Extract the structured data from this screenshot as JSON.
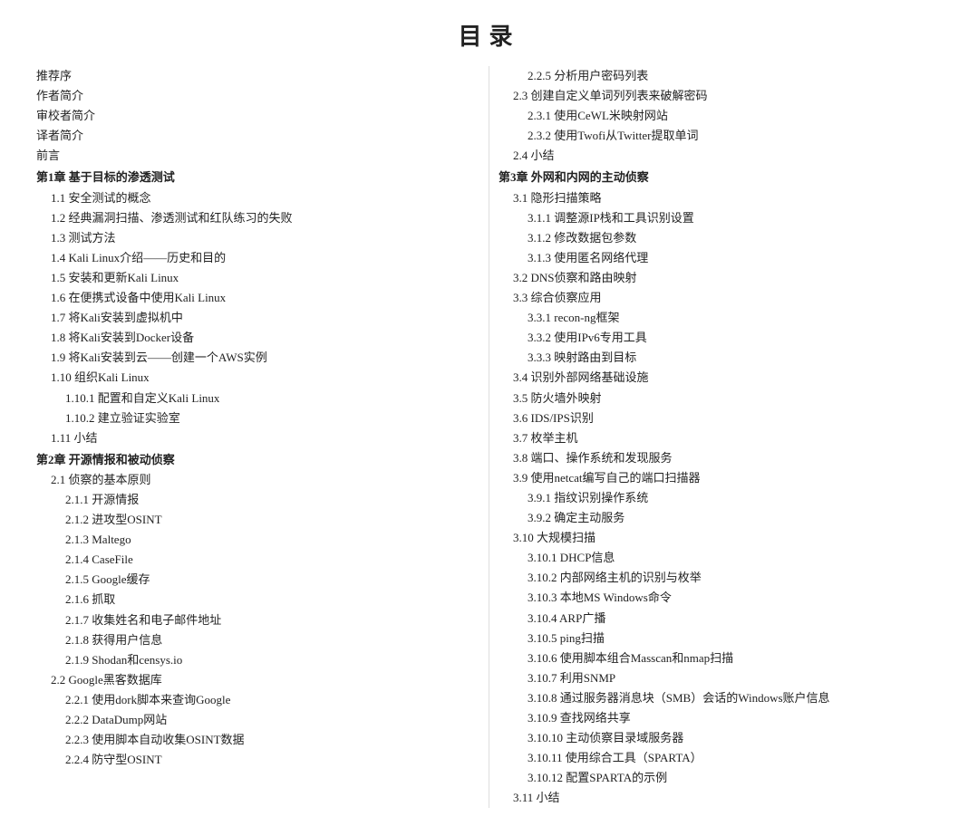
{
  "title": "目录",
  "left_col": [
    {
      "level": "plain",
      "text": "推荐序"
    },
    {
      "level": "plain",
      "text": "作者简介"
    },
    {
      "level": "plain",
      "text": "审校者简介"
    },
    {
      "level": "plain",
      "text": "译者简介"
    },
    {
      "level": "plain",
      "text": "前言"
    },
    {
      "level": "chapter",
      "text": "第1章   基于目标的渗透测试"
    },
    {
      "level": "section",
      "text": "1.1   安全测试的概念"
    },
    {
      "level": "section",
      "text": "1.2   经典漏洞扫描、渗透测试和红队练习的失败"
    },
    {
      "level": "section",
      "text": "1.3   测试方法"
    },
    {
      "level": "section",
      "text": "1.4   Kali   Linux介绍——历史和目的"
    },
    {
      "level": "section",
      "text": "1.5   安装和更新Kali   Linux"
    },
    {
      "level": "section",
      "text": "1.6   在便携式设备中使用Kali   Linux"
    },
    {
      "level": "section",
      "text": "1.7   将Kali安装到虚拟机中"
    },
    {
      "level": "section",
      "text": "1.8   将Kali安装到Docker设备"
    },
    {
      "level": "section",
      "text": "1.9   将Kali安装到云——创建一个AWS实例"
    },
    {
      "level": "section",
      "text": "1.10   组织Kali   Linux"
    },
    {
      "level": "subsection",
      "text": "1.10.1   配置和自定义Kali   Linux"
    },
    {
      "level": "subsection",
      "text": "1.10.2   建立验证实验室"
    },
    {
      "level": "section",
      "text": "1.11   小结"
    },
    {
      "level": "chapter",
      "text": "第2章   开源情报和被动侦察"
    },
    {
      "level": "section",
      "text": "2.1   侦察的基本原则"
    },
    {
      "level": "subsection",
      "text": "2.1.1   开源情报"
    },
    {
      "level": "subsection",
      "text": "2.1.2   进攻型OSINT"
    },
    {
      "level": "subsection",
      "text": "2.1.3   Maltego"
    },
    {
      "level": "subsection",
      "text": "2.1.4   CaseFile"
    },
    {
      "level": "subsection",
      "text": "2.1.5   Google缓存"
    },
    {
      "level": "subsection",
      "text": "2.1.6   抓取"
    },
    {
      "level": "subsection",
      "text": "2.1.7   收集姓名和电子邮件地址"
    },
    {
      "level": "subsection",
      "text": "2.1.8   获得用户信息"
    },
    {
      "level": "subsection",
      "text": "2.1.9   Shodan和censys.io"
    },
    {
      "level": "section",
      "text": "2.2   Google黑客数据库"
    },
    {
      "level": "subsection",
      "text": "2.2.1   使用dork脚本来查询Google"
    },
    {
      "level": "subsection",
      "text": "2.2.2   DataDump网站"
    },
    {
      "level": "subsection",
      "text": "2.2.3   使用脚本自动收集OSINT数据"
    },
    {
      "level": "subsection",
      "text": "2.2.4   防守型OSINT"
    }
  ],
  "right_col": [
    {
      "level": "subsection",
      "text": "2.2.5   分析用户密码列表"
    },
    {
      "level": "section",
      "text": "2.3   创建自定义单词列列表来破解密码"
    },
    {
      "level": "subsection",
      "text": "2.3.1   使用CeWL米映射网站"
    },
    {
      "level": "subsection",
      "text": "2.3.2   使用Twofi从Twitter提取单词"
    },
    {
      "level": "section",
      "text": "2.4   小结"
    },
    {
      "level": "chapter",
      "text": "第3章   外网和内网的主动侦察"
    },
    {
      "level": "section",
      "text": "3.1   隐形扫描策略"
    },
    {
      "level": "subsection",
      "text": "3.1.1   调整源IP栈和工具识别设置"
    },
    {
      "level": "subsection",
      "text": "3.1.2   修改数据包参数"
    },
    {
      "level": "subsection",
      "text": "3.1.3   使用匿名网络代理"
    },
    {
      "level": "section",
      "text": "3.2   DNS侦察和路由映射"
    },
    {
      "level": "section",
      "text": "3.3   综合侦察应用"
    },
    {
      "level": "subsection",
      "text": "3.3.1   recon-ng框架"
    },
    {
      "level": "subsection",
      "text": "3.3.2   使用IPv6专用工具"
    },
    {
      "level": "subsection",
      "text": "3.3.3   映射路由到目标"
    },
    {
      "level": "section",
      "text": "3.4   识别外部网络基础设施"
    },
    {
      "level": "section",
      "text": "3.5   防火墙外映射"
    },
    {
      "level": "section",
      "text": "3.6   IDS/IPS识别"
    },
    {
      "level": "section",
      "text": "3.7   枚举主机"
    },
    {
      "level": "section",
      "text": "3.8   端口、操作系统和发现服务"
    },
    {
      "level": "section",
      "text": "3.9   使用netcat编写自己的端口扫描器"
    },
    {
      "level": "subsection",
      "text": "3.9.1   指纹识别操作系统"
    },
    {
      "level": "subsection",
      "text": "3.9.2   确定主动服务"
    },
    {
      "level": "section",
      "text": "3.10   大规模扫描"
    },
    {
      "level": "subsection",
      "text": "3.10.1   DHCP信息"
    },
    {
      "level": "subsection",
      "text": "3.10.2   内部网络主机的识别与枚举"
    },
    {
      "level": "subsection",
      "text": "3.10.3   本地MS   Windows命令"
    },
    {
      "level": "subsection",
      "text": "3.10.4   ARP广播"
    },
    {
      "level": "subsection",
      "text": "3.10.5   ping扫描"
    },
    {
      "level": "subsection",
      "text": "3.10.6   使用脚本组合Masscan和nmap扫描"
    },
    {
      "level": "subsection",
      "text": "3.10.7   利用SNMP"
    },
    {
      "level": "subsection",
      "text": "3.10.8   通过服务器消息块（SMB）会话的Windows账户信息"
    },
    {
      "level": "subsection",
      "text": "3.10.9   查找网络共享"
    },
    {
      "level": "subsection",
      "text": "3.10.10   主动侦察目录域服务器"
    },
    {
      "level": "subsection",
      "text": "3.10.11   使用综合工具（SPARTA）"
    },
    {
      "level": "subsection",
      "text": "3.10.12   配置SPARTA的示例"
    },
    {
      "level": "section",
      "text": "3.11   小结"
    }
  ]
}
